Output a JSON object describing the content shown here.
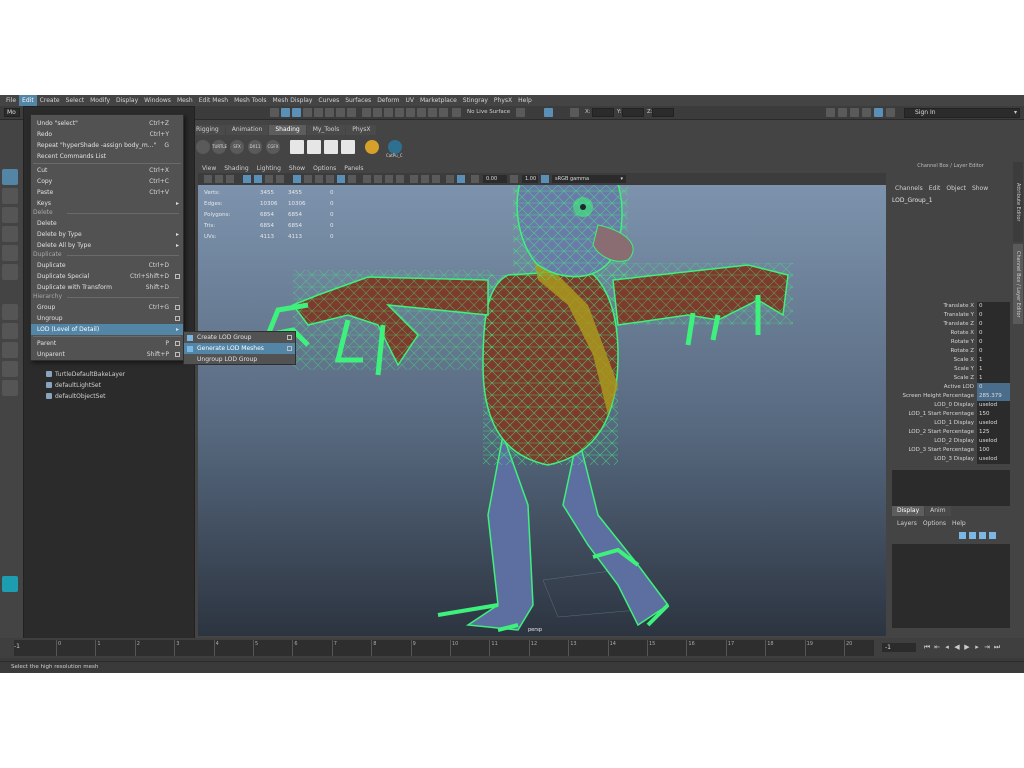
{
  "menubar": [
    "File",
    "Edit",
    "Create",
    "Select",
    "Modify",
    "Display",
    "Windows",
    "Mesh",
    "Edit Mesh",
    "Mesh Tools",
    "Mesh Display",
    "Curves",
    "Surfaces",
    "Deform",
    "UV",
    "Marketplace",
    "Stingray",
    "PhysX",
    "Help"
  ],
  "active_menu": "Edit",
  "statusline": {
    "mode_short": "Mo",
    "no_live_surface": "No Live Surface",
    "x_label": "X:",
    "y_label": "Y:",
    "z_label": "Z:",
    "sign_in": "Sign In"
  },
  "shelf": {
    "tabs": [
      "Rigging",
      "Animation",
      "Shading",
      "My_Tools",
      "PhysX"
    ],
    "active_tab": "Shading",
    "icon_labels": [
      "TURTLE",
      "SFX",
      "DX11",
      "CGFX",
      "CatPu_C"
    ]
  },
  "edit_menu": {
    "undo": {
      "label": "Undo \"select\"",
      "shortcut": "Ctrl+Z"
    },
    "redo": {
      "label": "Redo",
      "shortcut": "Ctrl+Y"
    },
    "repeat": {
      "label": "Repeat \"hyperShade -assign body_m...\"",
      "shortcut": "G"
    },
    "recent": {
      "label": "Recent Commands List"
    },
    "cut": {
      "label": "Cut",
      "shortcut": "Ctrl+X"
    },
    "copy": {
      "label": "Copy",
      "shortcut": "Ctrl+C"
    },
    "paste": {
      "label": "Paste",
      "shortcut": "Ctrl+V"
    },
    "keys": {
      "label": "Keys"
    },
    "delete_header": "Delete",
    "delete": {
      "label": "Delete"
    },
    "delete_by_type": {
      "label": "Delete by Type"
    },
    "delete_all_by_type": {
      "label": "Delete All by Type"
    },
    "duplicate_header": "Duplicate",
    "duplicate": {
      "label": "Duplicate",
      "shortcut": "Ctrl+D"
    },
    "duplicate_special": {
      "label": "Duplicate Special",
      "shortcut": "Ctrl+Shift+D"
    },
    "duplicate_transform": {
      "label": "Duplicate with Transform",
      "shortcut": "Shift+D"
    },
    "hierarchy_header": "Hierarchy",
    "group": {
      "label": "Group",
      "shortcut": "Ctrl+G"
    },
    "ungroup": {
      "label": "Ungroup"
    },
    "lod": {
      "label": "LOD (Level of Detail)"
    },
    "parent": {
      "label": "Parent",
      "shortcut": "P"
    },
    "unparent": {
      "label": "Unparent",
      "shortcut": "Shift+P"
    }
  },
  "lod_submenu": {
    "create": "Create LOD Group",
    "generate": "Generate LOD Meshes",
    "ungroup": "Ungroup LOD Group"
  },
  "outliner": [
    "TurtleDefaultBakeLayer",
    "defaultLightSet",
    "defaultObjectSet"
  ],
  "viewport": {
    "menu": [
      "View",
      "Shading",
      "Lighting",
      "Show",
      "Options",
      "Panels"
    ],
    "exposure": "0.00",
    "gamma": "1.00",
    "color_space": "sRGB gamma",
    "camera_label": "persp",
    "hud": [
      {
        "label": "Verts:",
        "a": "3455",
        "b": "3455",
        "c": "0"
      },
      {
        "label": "Edges:",
        "a": "10306",
        "b": "10306",
        "c": "0"
      },
      {
        "label": "Polygons:",
        "a": "6854",
        "b": "6854",
        "c": "0"
      },
      {
        "label": "Tris:",
        "a": "6854",
        "b": "6854",
        "c": "0"
      },
      {
        "label": "UVs:",
        "a": "4113",
        "b": "4113",
        "c": "0"
      }
    ]
  },
  "channel_box": {
    "title": "Channel Box / Layer Editor",
    "menu": [
      "Channels",
      "Edit",
      "Object",
      "Show"
    ],
    "object_name": "LOD_Group_1",
    "channels": [
      {
        "label": "Translate X",
        "value": "0"
      },
      {
        "label": "Translate Y",
        "value": "0"
      },
      {
        "label": "Translate Z",
        "value": "0"
      },
      {
        "label": "Rotate X",
        "value": "0"
      },
      {
        "label": "Rotate Y",
        "value": "0"
      },
      {
        "label": "Rotate Z",
        "value": "0"
      },
      {
        "label": "Scale X",
        "value": "1"
      },
      {
        "label": "Scale Y",
        "value": "1"
      },
      {
        "label": "Scale Z",
        "value": "1"
      },
      {
        "label": "Active LOD",
        "value": "0"
      },
      {
        "label": "Screen Height Percentage",
        "value": "285.379"
      },
      {
        "label": "LOD_0 Display",
        "value": "uselod"
      },
      {
        "label": "LOD_1 Start Percentage",
        "value": "150"
      },
      {
        "label": "LOD_1 Display",
        "value": "uselod"
      },
      {
        "label": "LOD_2 Start Percentage",
        "value": "125"
      },
      {
        "label": "LOD_2 Display",
        "value": "uselod"
      },
      {
        "label": "LOD_3 Start Percentage",
        "value": "100"
      },
      {
        "label": "LOD_3 Display",
        "value": "uselod"
      }
    ],
    "side_tabs": [
      "Attribute Editor",
      "Channel Box / Layer Editor"
    ]
  },
  "layer_editor": {
    "tabs": [
      "Display",
      "Anim"
    ],
    "menu": [
      "Layers",
      "Options",
      "Help"
    ]
  },
  "timeline": {
    "ticks": [
      "0",
      "1",
      "2",
      "3",
      "4",
      "5",
      "6",
      "7",
      "8",
      "9",
      "10",
      "11",
      "12",
      "13",
      "14",
      "15",
      "16",
      "17",
      "18",
      "19",
      "20"
    ],
    "start": "-1",
    "current": "-1"
  },
  "help_line": "Select the high resolution mesh",
  "colors": {
    "accent": "#5285a6",
    "wireframe": "#3ef07c"
  }
}
